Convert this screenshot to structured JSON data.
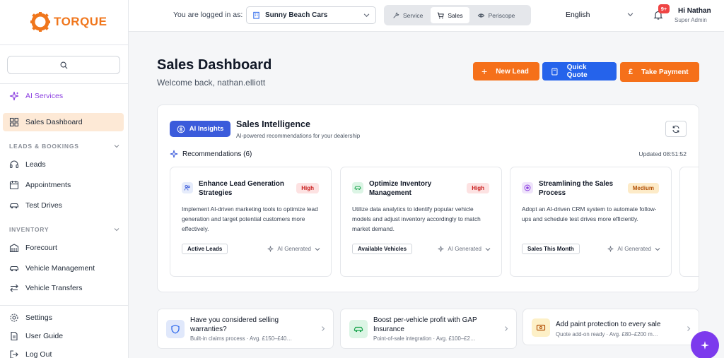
{
  "brand": {
    "name": "TORQUE",
    "color": "#f0761c"
  },
  "sidebar": {
    "search_icon": "search-icon",
    "ai_services": "AI Services",
    "sales_dashboard": "Sales Dashboard",
    "section_leads": "LEADS & BOOKINGS",
    "leads": "Leads",
    "appointments": "Appointments",
    "test_drives": "Test Drives",
    "section_inventory": "INVENTORY",
    "forecourt": "Forecourt",
    "vehicle_management": "Vehicle Management",
    "vehicle_transfers": "Vehicle Transfers",
    "settings": "Settings",
    "user_guide": "User Guide",
    "log_out": "Log Out"
  },
  "topbar": {
    "logged_in_label": "You are logged in as:",
    "dealer": "Sunny Beach Cars",
    "modules": [
      "Service",
      "Sales",
      "Periscope"
    ],
    "active_module": "Sales",
    "language": "English",
    "notification_badge": "9+",
    "user_greeting": "Hi Nathan",
    "user_role": "Super Admin"
  },
  "header": {
    "title": "Sales Dashboard",
    "welcome": "Welcome back, nathan.elliott",
    "new_lead": "New Lead",
    "quick_quote": "Quick Quote",
    "take_payment": "Take Payment"
  },
  "ai_panel": {
    "badge": "AI Insights",
    "title": "Sales Intelligence",
    "subtitle": "AI-powered recommendations for your dealership",
    "recommendations_label": "Recommendations (6)",
    "updated": "Updated 08:51:52",
    "cards": [
      {
        "title": "Enhance Lead Generation Strategies",
        "priority": "High",
        "description": "Implement AI-driven marketing tools to optimize lead generation and target potential customers more effectively.",
        "metric": "Active Leads",
        "source": "AI Generated",
        "icon": "users-icon"
      },
      {
        "title": "Optimize Inventory Management",
        "priority": "High",
        "description": "Utilize data analytics to identify popular vehicle models and adjust inventory accordingly to match market demand.",
        "metric": "Available Vehicles",
        "source": "AI Generated",
        "icon": "car-icon"
      },
      {
        "title": "Streamlining the Sales Process",
        "priority": "Medium",
        "description": "Adopt an AI-driven CRM system to automate follow-ups and schedule test drives more efficiently.",
        "metric": "Sales This Month",
        "source": "AI Generated",
        "icon": "target-icon"
      }
    ]
  },
  "suggestions": [
    {
      "title": "Have you considered selling warranties?",
      "subtitle": "Built-in claims process · Avg. £150–£40…",
      "icon": "shield-icon"
    },
    {
      "title": "Boost per-vehicle profit with GAP Insurance",
      "subtitle": "Point-of-sale integration · Avg. £100–£2…",
      "icon": "car-icon"
    },
    {
      "title": "Add paint protection to every sale",
      "subtitle": "Quote add-on ready · Avg. £80–£200 m…",
      "icon": "cash-icon"
    }
  ],
  "colors": {
    "orange": "#f5701a",
    "blue": "#2563eb",
    "purple": "#7c3aed",
    "ai_badge": "#3b5bdb"
  }
}
